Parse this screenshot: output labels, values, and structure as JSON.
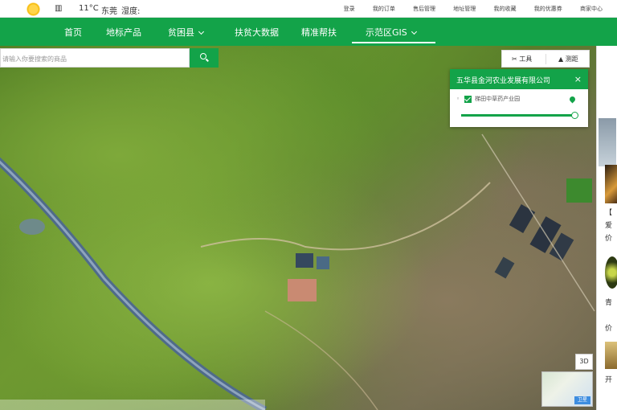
{
  "topbar": {
    "temperature": "11°C",
    "city": "东莞",
    "humidity_label": "湿度:",
    "links": [
      "登录",
      "我的订单",
      "售后管理",
      "地址管理",
      "我的收藏",
      "我的优惠券",
      "商家中心"
    ]
  },
  "nav": {
    "items": [
      "首页",
      "地标产品",
      "贫困县",
      "扶贫大数据",
      "精准帮扶",
      "示范区GIS"
    ],
    "active_index": 5
  },
  "search": {
    "placeholder": "请输入你要搜索的商品"
  },
  "tools": {
    "tool_label": "工具",
    "measure_label": "测距"
  },
  "popup": {
    "title": "五华县金河农业发展有限公司",
    "close": "×",
    "layer_label": "梯田中草药产业园",
    "opacity": 1.0
  },
  "map_controls": {
    "btn_3d": "3D",
    "minimap_label": "卫星"
  },
  "side_panel": {
    "texts": [
      "【",
      "爱",
      "价",
      "青",
      "价",
      "开"
    ]
  },
  "colors": {
    "brand": "#13a349",
    "accent_text": "#ffffff"
  }
}
